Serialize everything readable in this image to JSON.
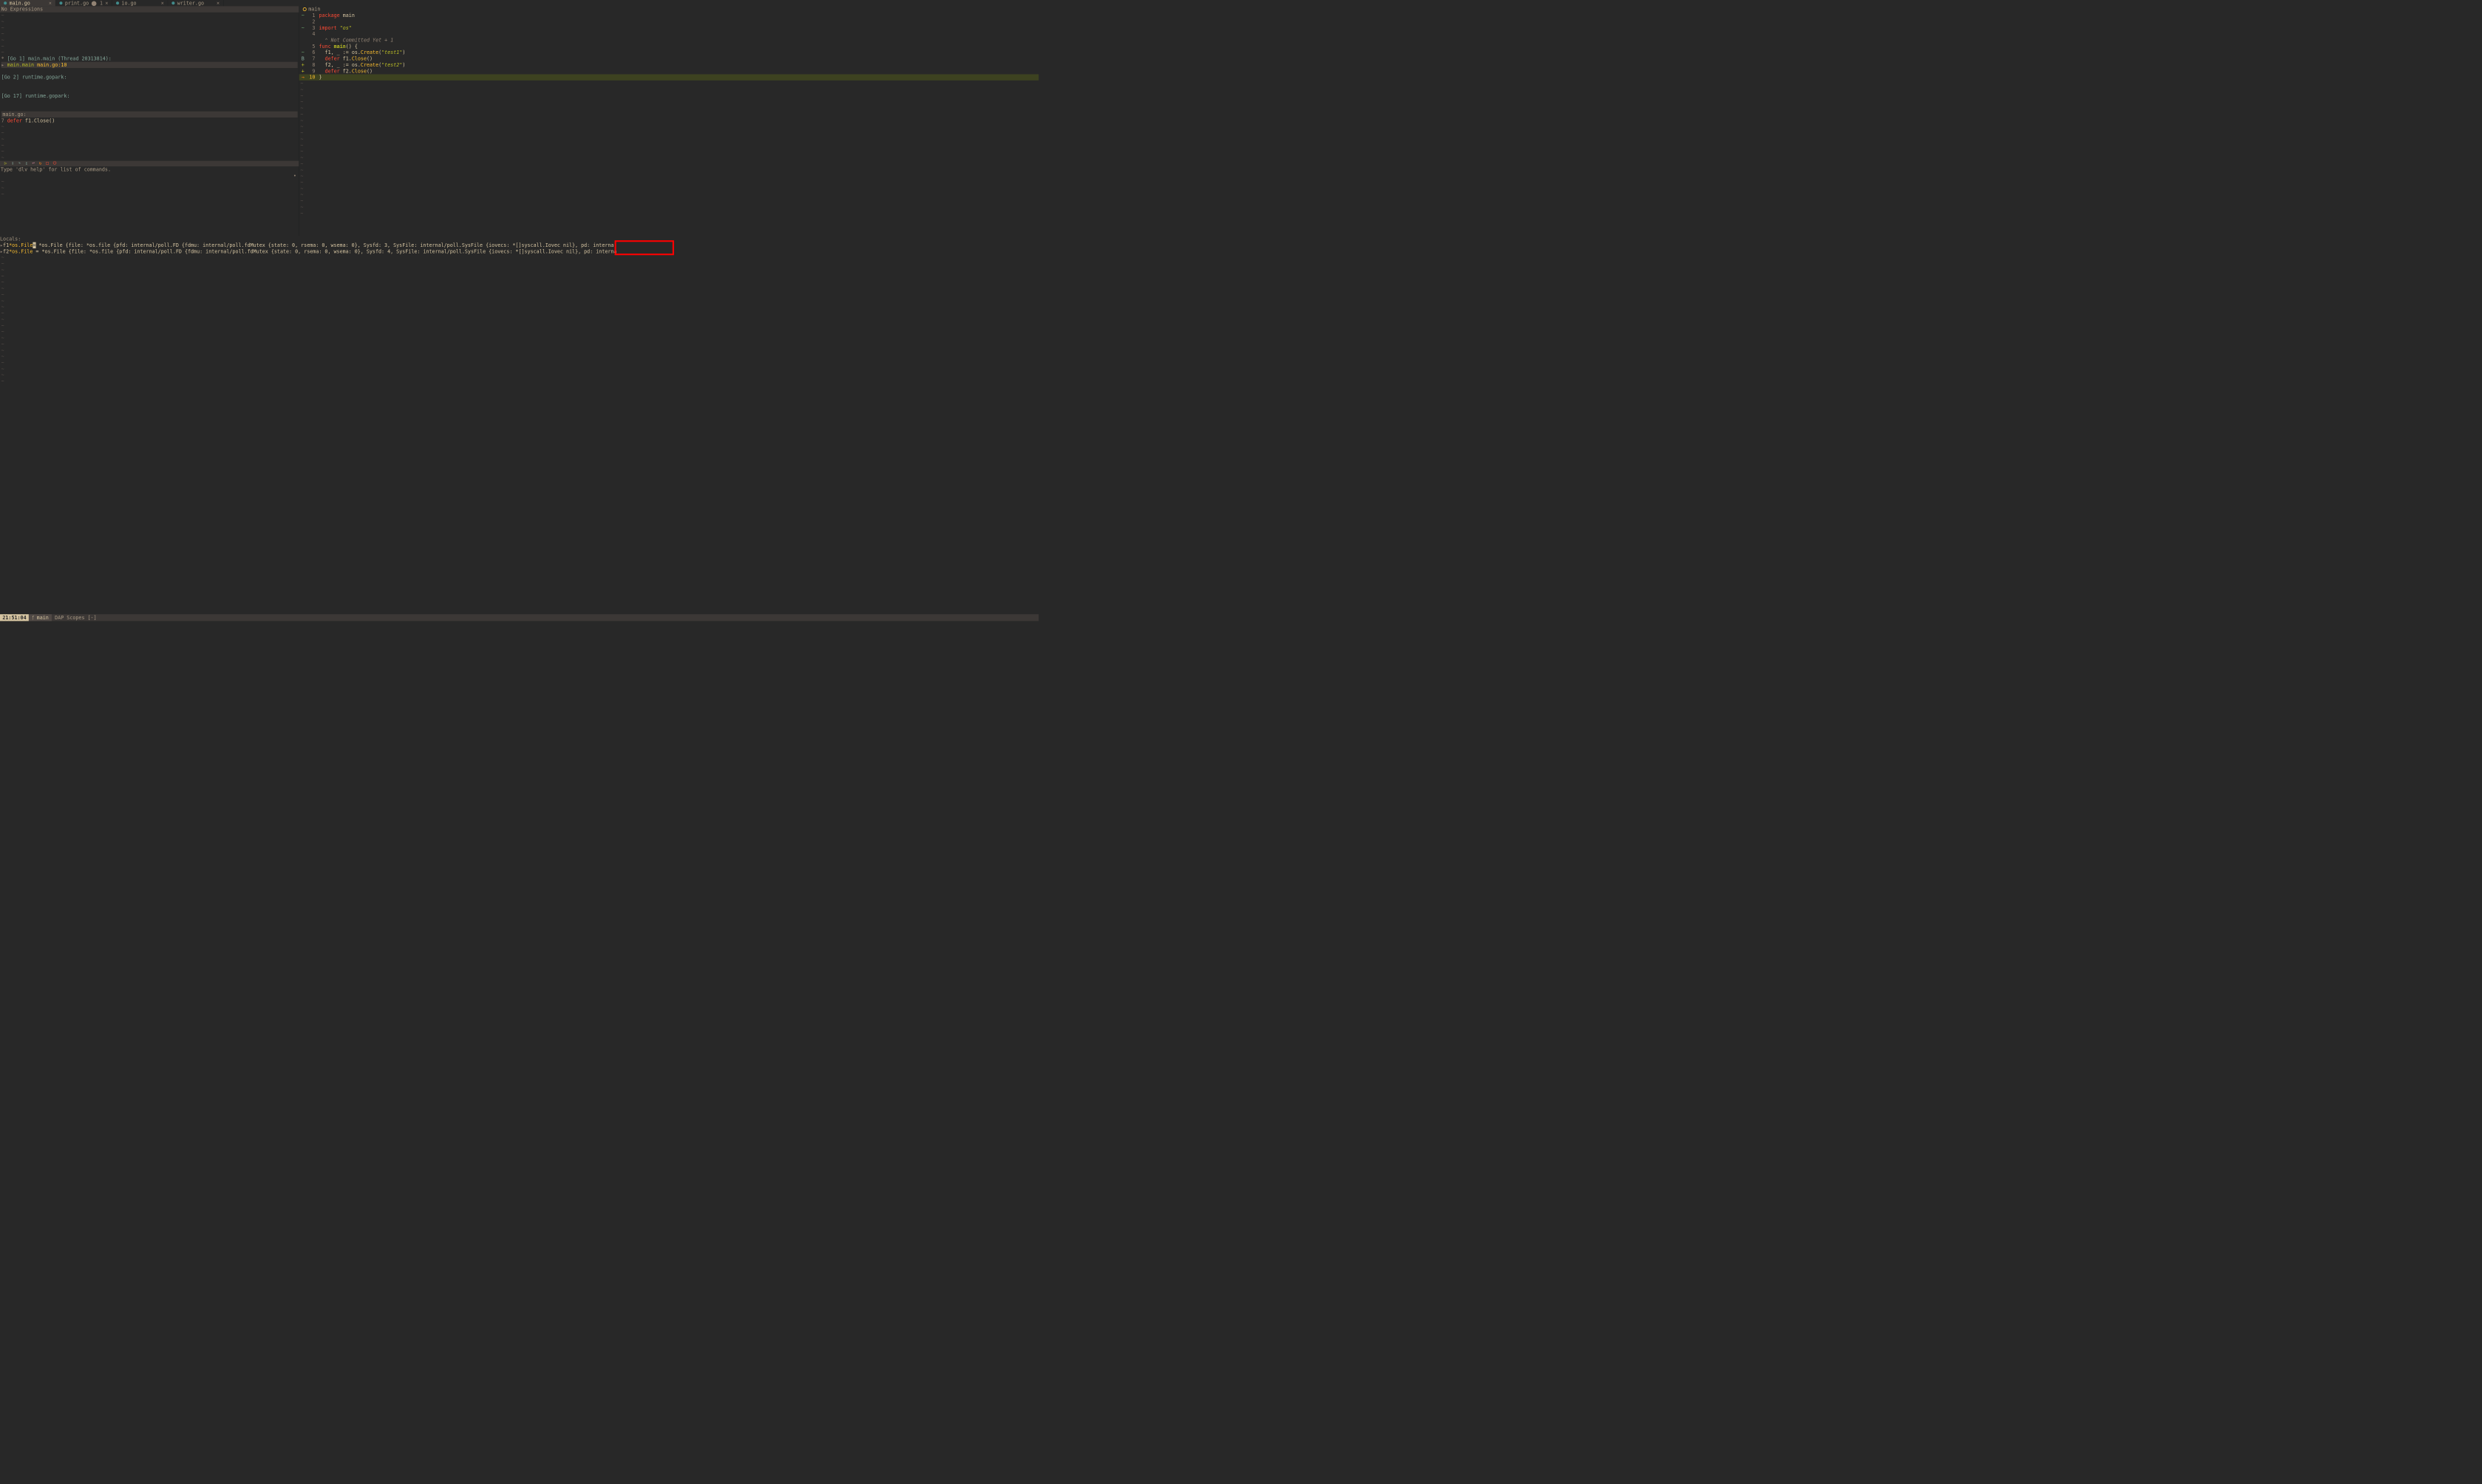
{
  "tabs": [
    {
      "name": "main.go",
      "modified": "",
      "active": true
    },
    {
      "name": "print.go",
      "modified": "⬤ 1",
      "active": false
    },
    {
      "name": "io.go",
      "modified": "",
      "active": false
    },
    {
      "name": "writer.go",
      "modified": "",
      "active": false
    }
  ],
  "expressions": {
    "title": "No Expressions"
  },
  "threads": [
    {
      "prefix": "*",
      "label": "[Go 1] main.main (Thread 20313814)",
      "suffix": ":"
    },
    {
      "prefix": " ",
      "label": "[Go 2] runtime.gopark",
      "suffix": ":"
    },
    {
      "prefix": " ",
      "label": "[Go 17] runtime.gopark",
      "suffix": ":"
    }
  ],
  "current_frame": {
    "arrow": "▸",
    "func": "main.main",
    "loc": "main.go:10"
  },
  "breakpoints": {
    "file_label": "main.go:",
    "line_no": "7",
    "kw": "defer",
    "rest": " f1.Close()"
  },
  "repl": {
    "help": "Type 'dlv help' for list of commands."
  },
  "winbar": {
    "name": "main"
  },
  "code": {
    "lines": [
      {
        "sign": "~",
        "signClass": "tilde",
        "n": "1",
        "html": "<span class='tok-kw'>package</span> <span class='tok-pkg'>main</span>"
      },
      {
        "sign": "",
        "signClass": "",
        "n": "2",
        "html": ""
      },
      {
        "sign": "~",
        "signClass": "tilde",
        "n": "3",
        "html": "<span class='tok-kw'>import</span> <span class='tok-str'>\"os\"</span>"
      },
      {
        "sign": "",
        "signClass": "",
        "n": "4",
        "html": ""
      },
      {
        "sign": "",
        "signClass": "",
        "n": "",
        "html": "  <span class='blame-marker'>⌃</span> <span class='tok-comment'>Not Committed Yet + 1</span>"
      },
      {
        "sign": "",
        "signClass": "",
        "n": "5",
        "html": "<span class='tok-kw'>func</span> <span class='tok-funcdef'>main</span><span class='tok-op'>() {</span>"
      },
      {
        "sign": "~",
        "signClass": "tilde",
        "n": "6",
        "html": "  f1, _ <span class='tok-op'>:=</span> os.<span class='tok-field'>Create</span>(<span class='tok-str'>\"test1\"</span>)"
      },
      {
        "sign": "B",
        "signClass": "bp",
        "n": "7",
        "html": "  <span class='tok-kw'>defer</span> f1.<span class='tok-field'>Close</span>()"
      },
      {
        "sign": "+",
        "signClass": "plus",
        "n": "8",
        "html": "  f2, _ <span class='tok-op'>:=</span> os.<span class='tok-field'>Create</span>(<span class='tok-str'>\"test2\"</span>)"
      },
      {
        "sign": "+",
        "signClass": "plus",
        "n": "9",
        "html": "  <span class='tok-kw'>defer</span> f2.<span class='tok-field'>Close</span>()"
      },
      {
        "sign": "→",
        "signClass": "arrow",
        "n": "10",
        "html": "<span class='tok-op'>}</span>",
        "current": true
      }
    ]
  },
  "locals": {
    "title": "Locals:",
    "rows": [
      {
        "arrow": "▸",
        "var": "f1",
        "type": "*os.File",
        "cursor": true,
        "eq": "=",
        "pre_hl": " *os.File {file: *os.file {pfd: internal/poll.FD {fdmu: internal/poll.fdMutex {state: 0, rsema: 0, wsema: 0}",
        "hl": " Sysfd: 3, ",
        "post_hl": "SysFile: internal/poll.SysFile {iovecs: *[]syscall.Iovec nil}, pd: interna"
      },
      {
        "arrow": "▸",
        "var": "f2",
        "type": "*os.File",
        "cursor": false,
        "eq": "=",
        "pre_hl": " *os.File {file: *os.file {pfd: internal/poll.FD {fdmu: internal/poll.fdMutex {state: 0, rsema: 0, wsema: 0}",
        "hl": " Sysfd: 4, ",
        "post_hl": "SysFile: internal/poll.SysFile {iovecs: *[]syscall.Iovec nil}, pd: interna"
      }
    ]
  },
  "status": {
    "clock": "21:51:04",
    "branch_icon": "ᚶ",
    "branch": "main",
    "mode": "DAP Scopes [-]"
  }
}
